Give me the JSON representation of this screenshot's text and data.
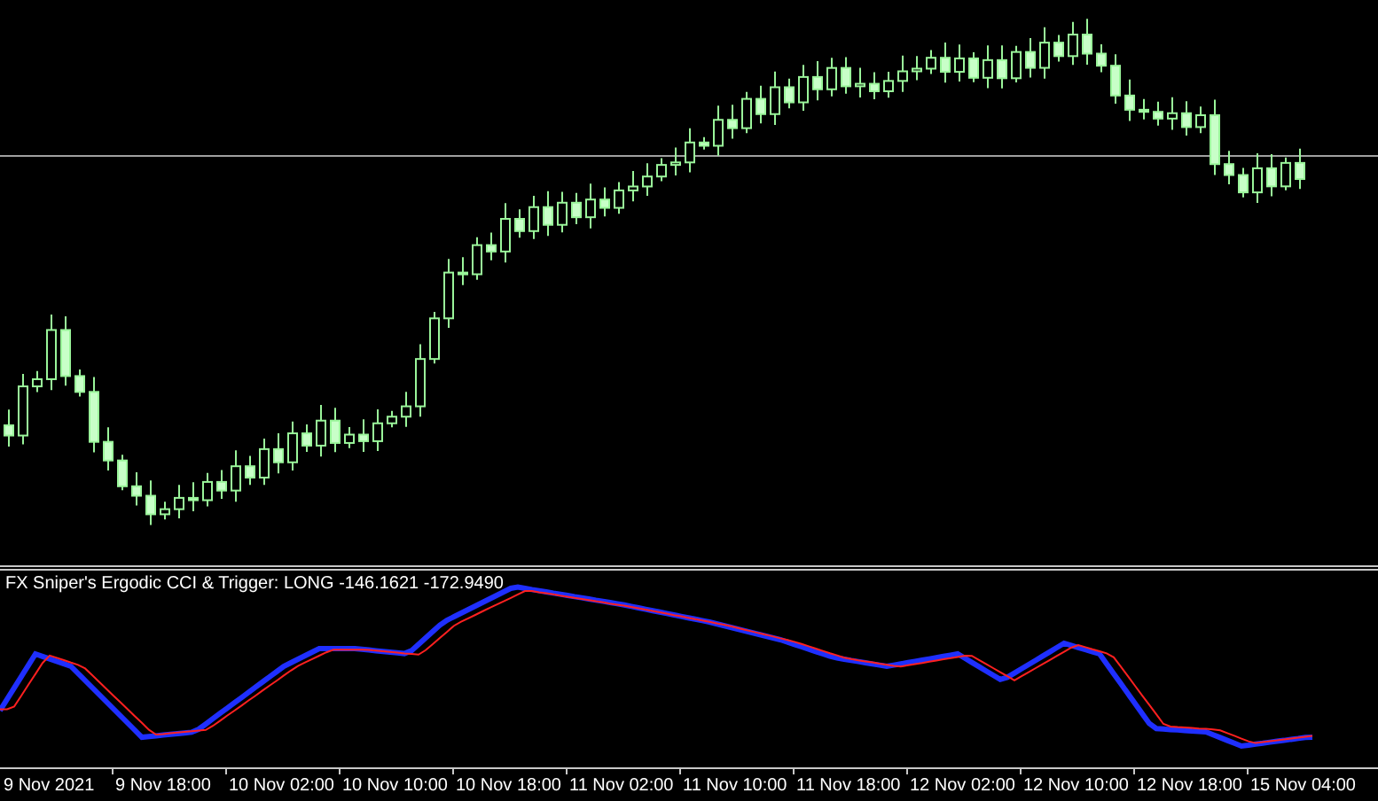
{
  "indicator": {
    "title": "FX Sniper's Ergodic CCI & Trigger: LONG -146.1621 -172.9490"
  },
  "time_axis": {
    "labels": [
      "9 Nov 2021",
      "9 Nov 18:00",
      "10 Nov 02:00",
      "10 Nov 10:00",
      "10 Nov 18:00",
      "11 Nov 02:00",
      "11 Nov 10:00",
      "11 Nov 18:00",
      "12 Nov 02:00",
      "12 Nov 10:00",
      "12 Nov 18:00",
      "15 Nov 04:00"
    ]
  }
}
